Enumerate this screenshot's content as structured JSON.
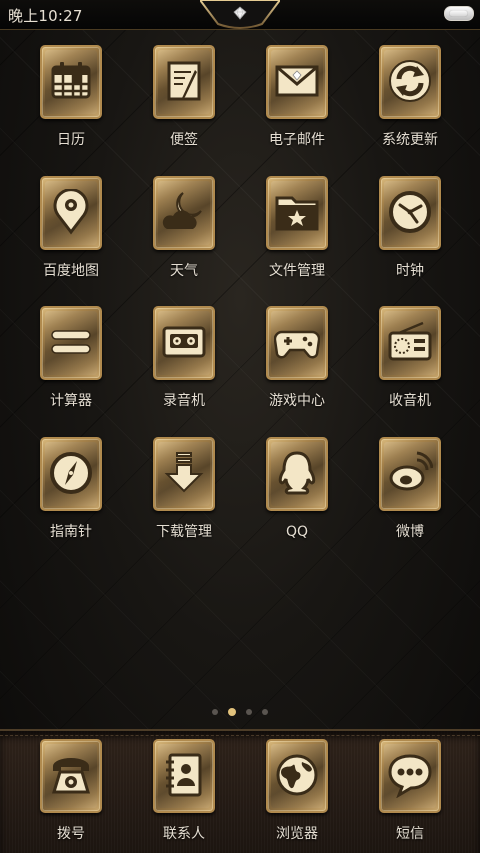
{
  "status_bar": {
    "time": "晚上10:27"
  },
  "home": {
    "apps": [
      {
        "label": "日历",
        "icon": "calendar-icon"
      },
      {
        "label": "便签",
        "icon": "notepad-icon"
      },
      {
        "label": "电子邮件",
        "icon": "envelope-icon"
      },
      {
        "label": "系统更新",
        "icon": "refresh-icon"
      },
      {
        "label": "百度地图",
        "icon": "map-pin-icon"
      },
      {
        "label": "天气",
        "icon": "weather-cloud-moon-icon"
      },
      {
        "label": "文件管理",
        "icon": "folder-icon"
      },
      {
        "label": "时钟",
        "icon": "clock-icon"
      },
      {
        "label": "计算器",
        "icon": "calculator-equals-icon"
      },
      {
        "label": "录音机",
        "icon": "cassette-icon"
      },
      {
        "label": "游戏中心",
        "icon": "gamepad-icon"
      },
      {
        "label": "收音机",
        "icon": "radio-icon"
      },
      {
        "label": "指南针",
        "icon": "compass-icon"
      },
      {
        "label": "下载管理",
        "icon": "download-icon"
      },
      {
        "label": "QQ",
        "icon": "qq-penguin-icon"
      },
      {
        "label": "微博",
        "icon": "weibo-icon"
      }
    ]
  },
  "pager": {
    "page_count": 4,
    "active_page": 2
  },
  "dock": {
    "apps": [
      {
        "label": "拨号",
        "icon": "telephone-icon"
      },
      {
        "label": "联系人",
        "icon": "contacts-book-icon"
      },
      {
        "label": "浏览器",
        "icon": "globe-icon"
      },
      {
        "label": "短信",
        "icon": "message-bubble-icon"
      }
    ]
  },
  "theme": {
    "gold": "#d4b173",
    "dark_gold": "#6b5432",
    "label_color": "#e5ded2",
    "dot_active": "#e2c27c"
  }
}
